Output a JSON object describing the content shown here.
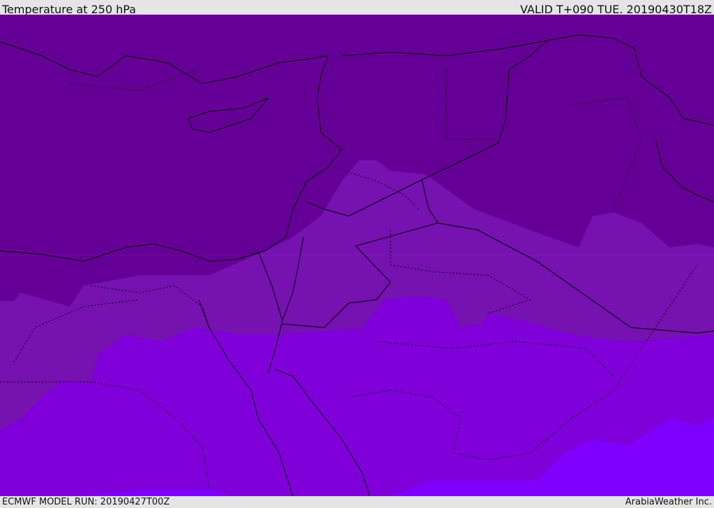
{
  "header": {
    "title": "Temperature at 250 hPa",
    "valid": "VALID T+090 TUE. 20190430T18Z"
  },
  "footer": {
    "model_run": "ECMWF MODEL RUN: 20190427T00Z",
    "credit": "ArabiaWeather Inc."
  },
  "colors": {
    "band_coldest": "#650096",
    "band_cold": "#7512b0",
    "band_mild": "#7f00d8",
    "band_warm": "#7f00ff",
    "background": "#e5e5e5"
  }
}
